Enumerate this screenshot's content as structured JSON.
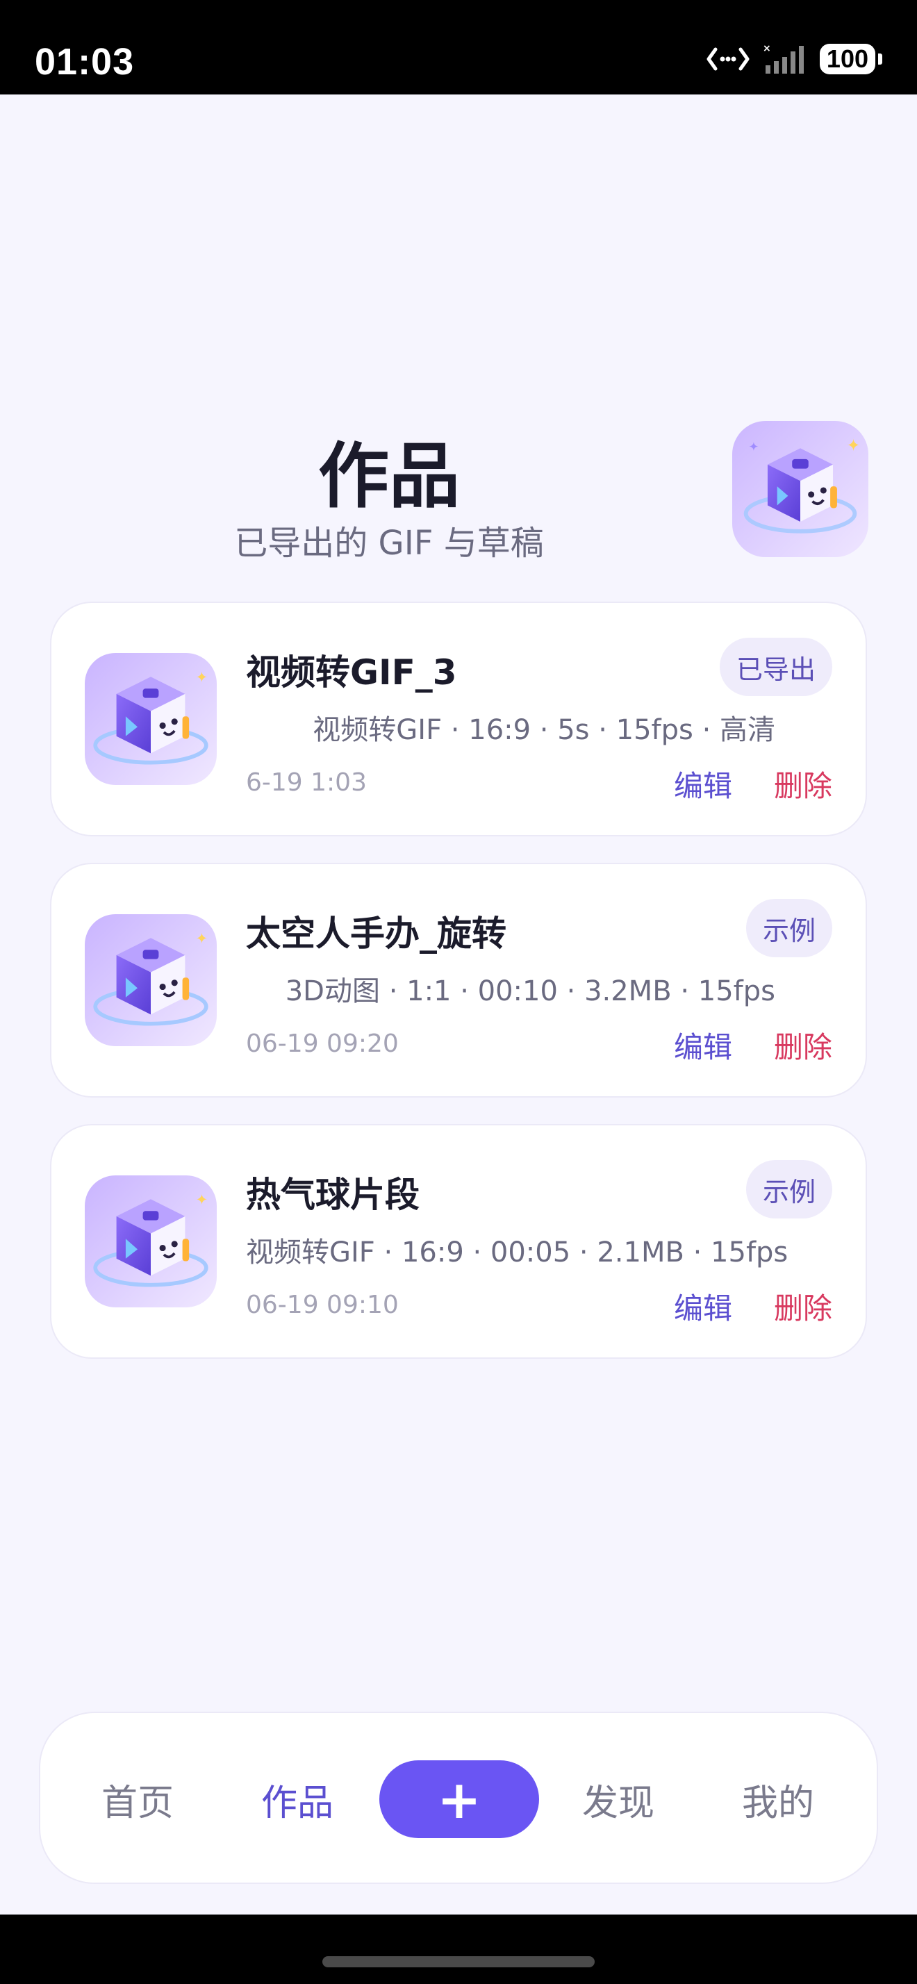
{
  "status_bar": {
    "time": "01:03",
    "battery": "100"
  },
  "header": {
    "title": "作品",
    "subtitle": "已导出的 GIF 与草稿"
  },
  "works": [
    {
      "title": "视频转GIF_3",
      "badge": "已导出",
      "meta": "视频转GIF · 16:9 · 5s · 15fps · 高清",
      "date": "6-19 1:03",
      "edit": "编辑",
      "delete": "删除"
    },
    {
      "title": "太空人手办_旋转",
      "badge": "示例",
      "meta": "3D动图 · 1:1 · 00:10 · 3.2MB · 15fps",
      "date": "06-19 09:20",
      "edit": "编辑",
      "delete": "删除"
    },
    {
      "title": "热气球片段",
      "badge": "示例",
      "meta": "视频转GIF · 16:9 · 00:05 · 2.1MB · 15fps",
      "date": "06-19 09:10",
      "edit": "编辑",
      "delete": "删除"
    }
  ],
  "tabbar": {
    "home": "首页",
    "works": "作品",
    "add": "+",
    "discover": "发现",
    "mine": "我的",
    "active": "works",
    "accent_color": "#6a55f3"
  },
  "colors": {
    "background": "#f6f5fe",
    "accent": "#5b4fd0",
    "danger": "#d8395f"
  }
}
